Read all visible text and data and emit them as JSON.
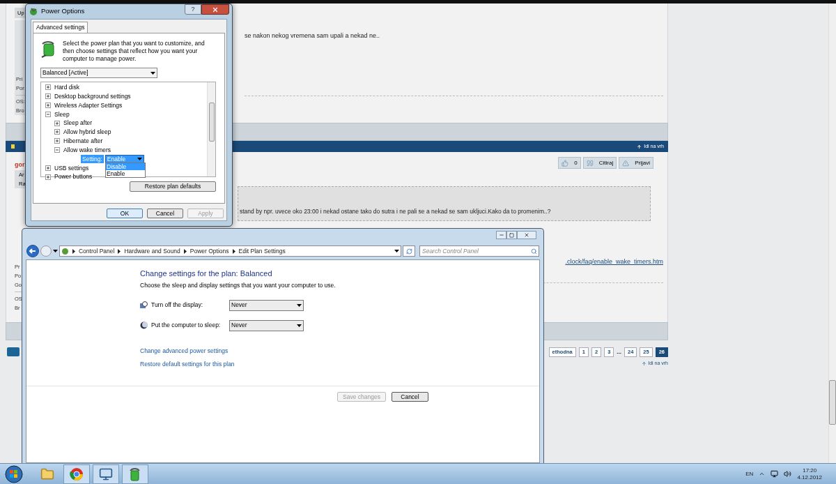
{
  "forum": {
    "post_1": {
      "user_button": "Up",
      "user_info": [
        "Pri",
        "Por"
      ],
      "system_info": [
        "OS:",
        "Bro"
      ],
      "text": "se nakon nekog vremena sam upali a nekad ne.."
    },
    "post_2_header": {
      "back_to_top": "Idi na vrh"
    },
    "post_2": {
      "author": "gor",
      "user_badges": [
        "Ar",
        "Ra"
      ],
      "actions": [
        {
          "kind": "like",
          "label": "0"
        },
        {
          "kind": "quote",
          "label": "Citiraj"
        },
        {
          "kind": "report",
          "label": "Prijavi"
        }
      ],
      "quote": "stand by npr. uvece oko 23:00 i nekad ostane tako do sutra i ne pali se a nekad se sam ukljuci.Kako da to promenim..?",
      "link": ".clock/faq/enable_wake_timers.htm",
      "user_info": [
        "Pr",
        "Po",
        "Go"
      ],
      "system_info": [
        "OS",
        "Br"
      ]
    },
    "pagination": {
      "pages": [
        {
          "kind": "prev",
          "label": "ethodna"
        },
        {
          "kind": "page",
          "label": "1",
          "selected": false
        },
        {
          "kind": "page",
          "label": "2",
          "selected": false
        },
        {
          "kind": "page",
          "label": "3",
          "selected": false
        },
        {
          "kind": "ellipsis",
          "label": "..."
        },
        {
          "kind": "page",
          "label": "24",
          "selected": false
        },
        {
          "kind": "page",
          "label": "25",
          "selected": false
        },
        {
          "kind": "page",
          "label": "26",
          "selected": true
        }
      ],
      "back_to_top": "Idi na vrh"
    }
  },
  "power_options": {
    "title": "Power Options",
    "help_button": "?",
    "tabs": [
      {
        "label": "Advanced settings",
        "selected": true
      }
    ],
    "description": "Select the power plan that you want to customize, and then choose settings that reflect how you want your computer to manage power.",
    "plan": "Balanced [Active]",
    "tree": [
      {
        "label": "Hard disk",
        "expanded": false
      },
      {
        "label": "Desktop background settings",
        "expanded": false
      },
      {
        "label": "Wireless Adapter Settings",
        "expanded": false
      },
      {
        "label": "Sleep",
        "expanded": true,
        "children": [
          {
            "label": "Sleep after",
            "expanded": false
          },
          {
            "label": "Allow hybrid sleep",
            "expanded": false
          },
          {
            "label": "Hibernate after",
            "expanded": false
          },
          {
            "label": "Allow wake timers",
            "expanded": true,
            "setting": {
              "label": "Setting:",
              "value": "Enable",
              "options": [
                {
                  "label": "Disable",
                  "highlighted": true
                },
                {
                  "label": "Enable",
                  "highlighted": false
                }
              ]
            }
          }
        ]
      },
      {
        "label": "USB settings",
        "expanded": false
      },
      {
        "label": "Power buttons",
        "expanded": false
      }
    ],
    "restore_button": "Restore plan defaults",
    "buttons": [
      {
        "label": "OK",
        "disabled": false
      },
      {
        "label": "Cancel",
        "disabled": false
      },
      {
        "label": "Apply",
        "disabled": true
      }
    ]
  },
  "control_panel": {
    "breadcrumb": [
      "Control Panel",
      "Hardware and Sound",
      "Power Options",
      "Edit Plan Settings"
    ],
    "search": {
      "placeholder": "Search Control Panel"
    },
    "heading": "Change settings for the plan: Balanced",
    "subtitle": "Choose the sleep and display settings that you want your computer to use.",
    "settings": [
      {
        "kind": "display",
        "label": "Turn off the display:",
        "value": "Never"
      },
      {
        "kind": "sleep",
        "label": "Put the computer to sleep:",
        "value": "Never"
      }
    ],
    "links": [
      "Change advanced power settings",
      "Restore default settings for this plan"
    ],
    "buttons": [
      {
        "label": "Save changes",
        "disabled": true
      },
      {
        "label": "Cancel",
        "disabled": false
      }
    ]
  },
  "taskbar": {
    "language": "EN",
    "time": "17:20",
    "date": "4.12.2012"
  }
}
